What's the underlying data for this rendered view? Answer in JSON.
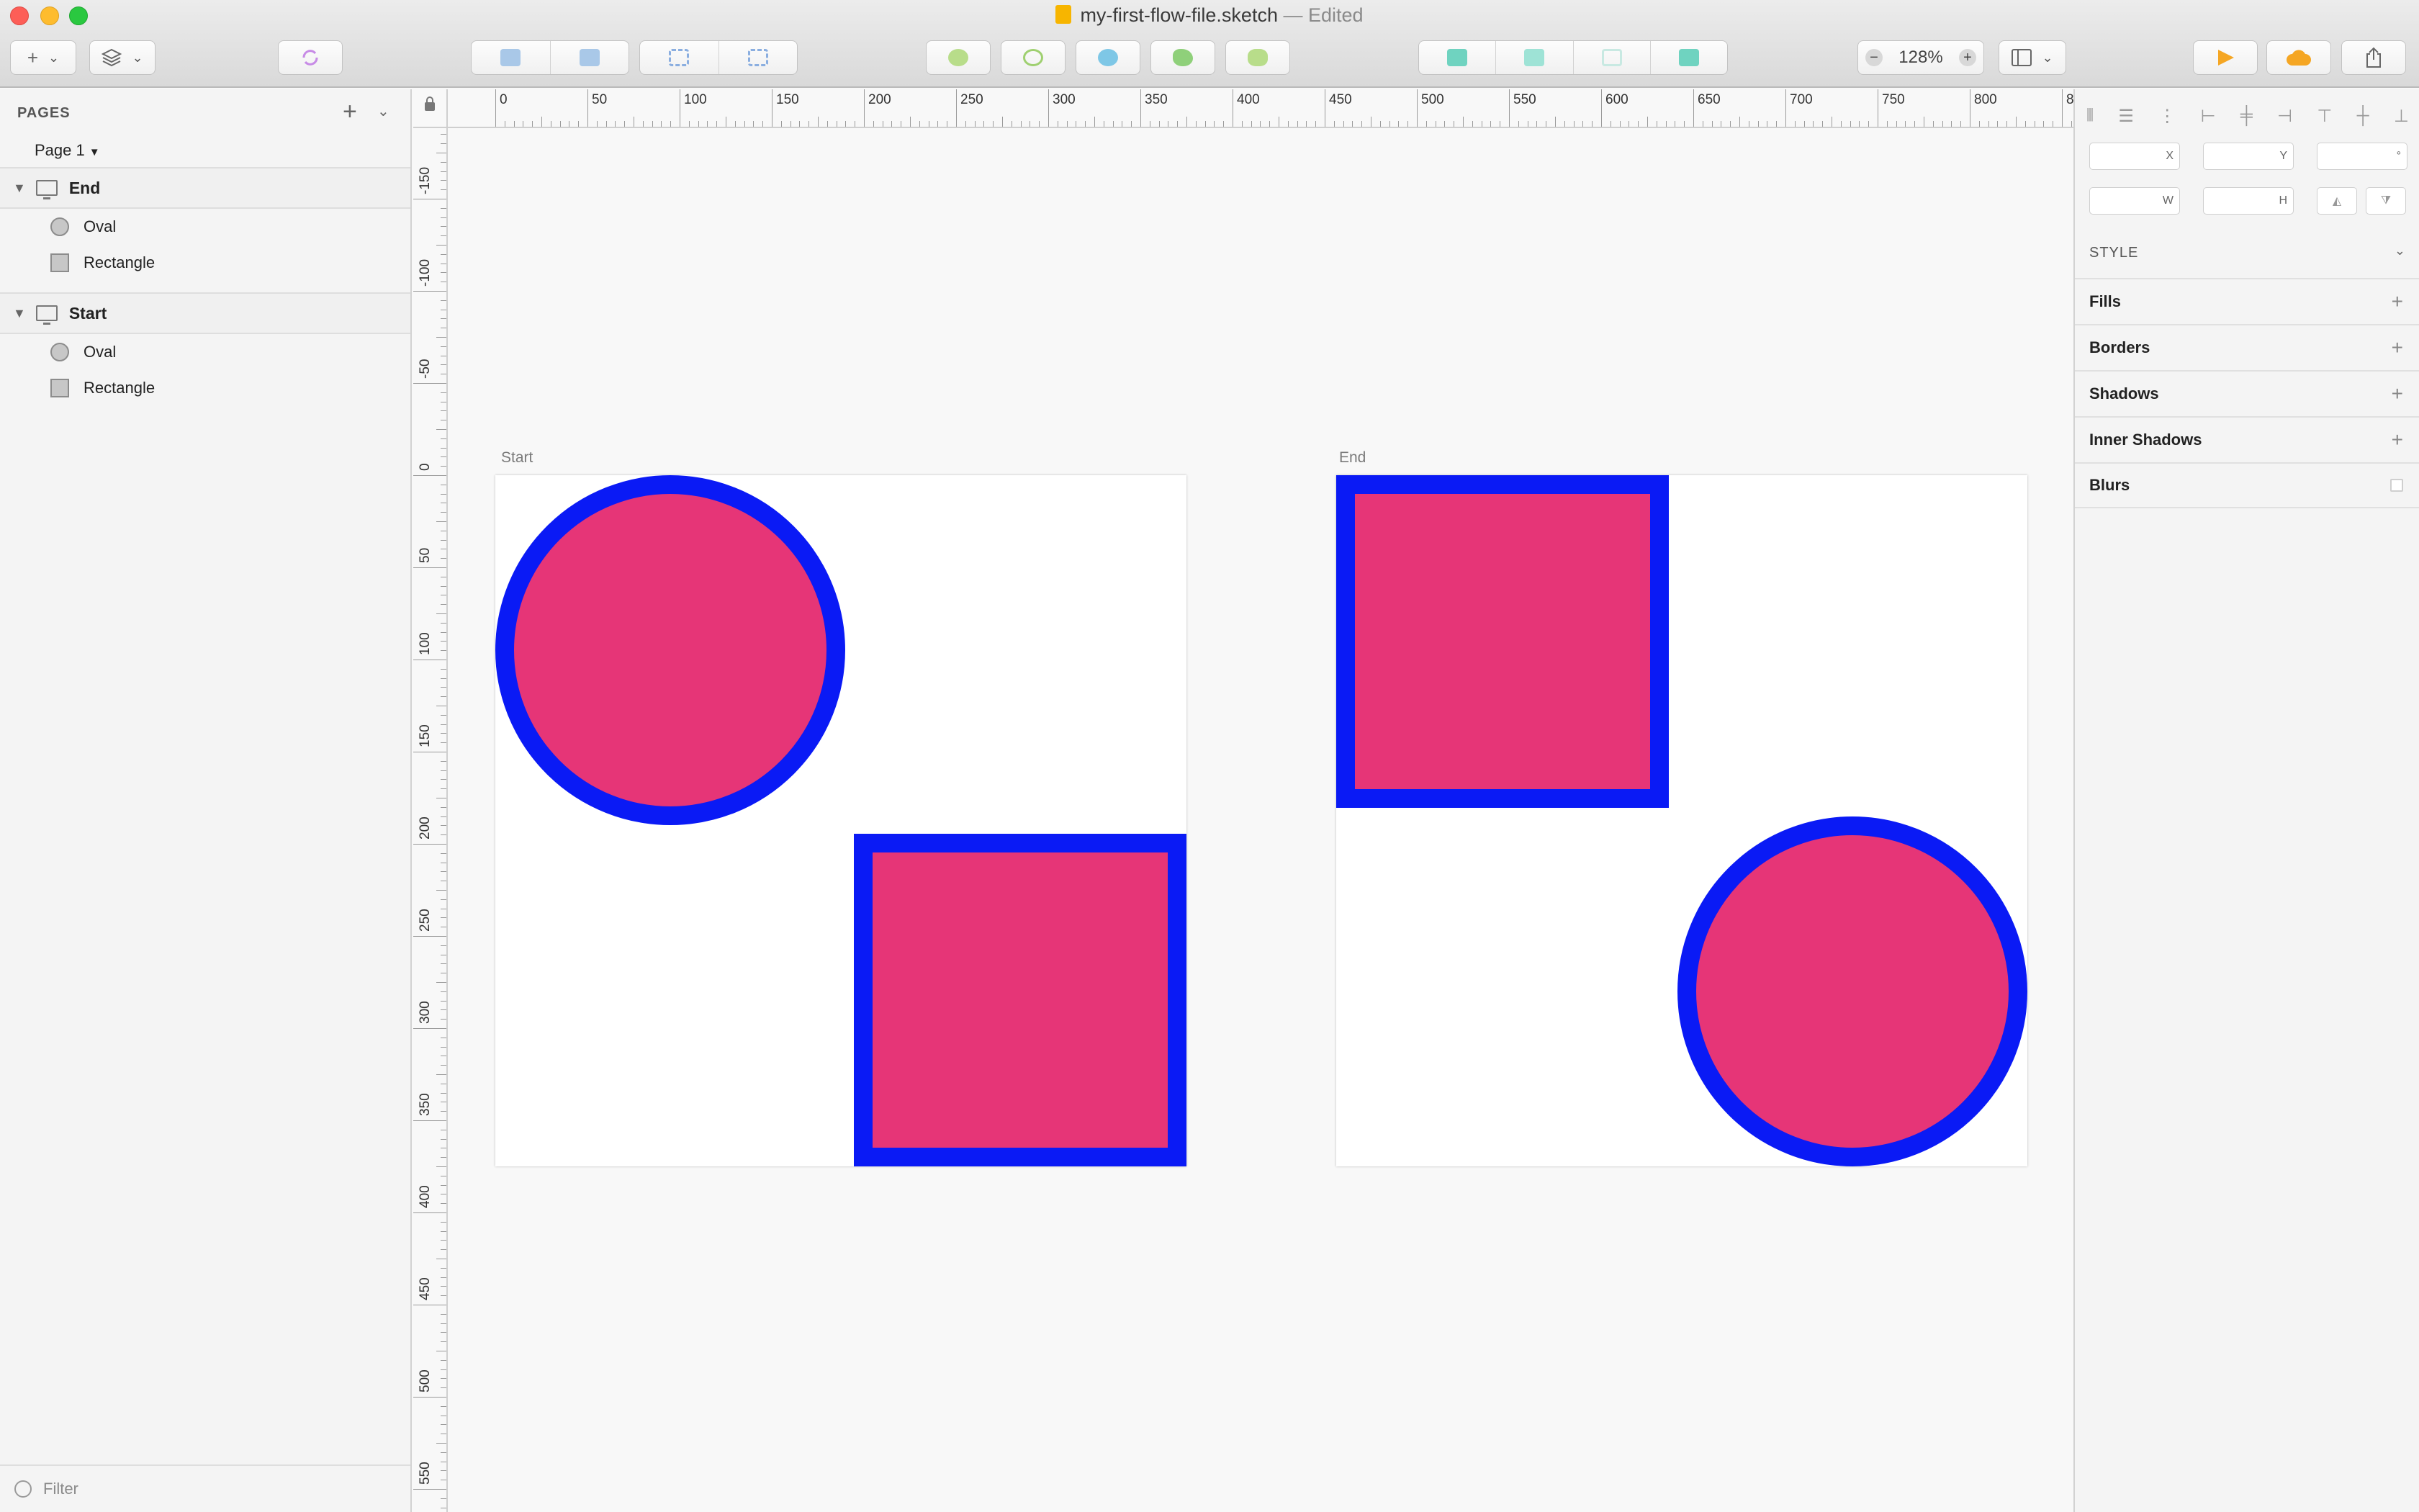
{
  "window": {
    "document_title": "my-first-flow-file.sketch",
    "edited_suffix": "— Edited"
  },
  "toolbar": {
    "insert_icon": "plus-icon",
    "layers_icon": "layers-stack-icon",
    "zoom_level": "128%",
    "zoom_out": "−",
    "zoom_in": "+"
  },
  "sidebar": {
    "pages_header": "PAGES",
    "add_page": "+",
    "collapse": "⌄",
    "current_page": "Page 1",
    "artboards": [
      {
        "name": "End",
        "layers": [
          {
            "name": "Oval",
            "kind": "oval"
          },
          {
            "name": "Rectangle",
            "kind": "rectangle"
          }
        ]
      },
      {
        "name": "Start",
        "layers": [
          {
            "name": "Oval",
            "kind": "oval"
          },
          {
            "name": "Rectangle",
            "kind": "rectangle"
          }
        ]
      }
    ],
    "filter_placeholder": "Filter"
  },
  "canvas": {
    "ruler_h_labels": [
      "0",
      "50",
      "100",
      "150",
      "200",
      "250",
      "300",
      "350",
      "400",
      "450",
      "500",
      "550",
      "600",
      "650",
      "700",
      "750",
      "800",
      "8"
    ],
    "ruler_v_labels": [
      "-150",
      "-100",
      "-50",
      "0",
      "50",
      "100",
      "150",
      "200",
      "250",
      "300",
      "350",
      "400",
      "450",
      "500",
      "550"
    ],
    "artboard_start_label": "Start",
    "artboard_end_label": "End",
    "colors": {
      "shape_fill": "#e63577",
      "shape_border": "#0a1af5",
      "artboard_bg": "#ffffff"
    }
  },
  "inspector": {
    "field_x": "X",
    "field_y": "Y",
    "field_rotation": "°",
    "field_w": "W",
    "field_h": "H",
    "style_header": "STYLE",
    "sections": {
      "fills": "Fills",
      "borders": "Borders",
      "shadows": "Shadows",
      "inner_shadows": "Inner Shadows",
      "blurs": "Blurs"
    },
    "add_symbol": "+"
  }
}
